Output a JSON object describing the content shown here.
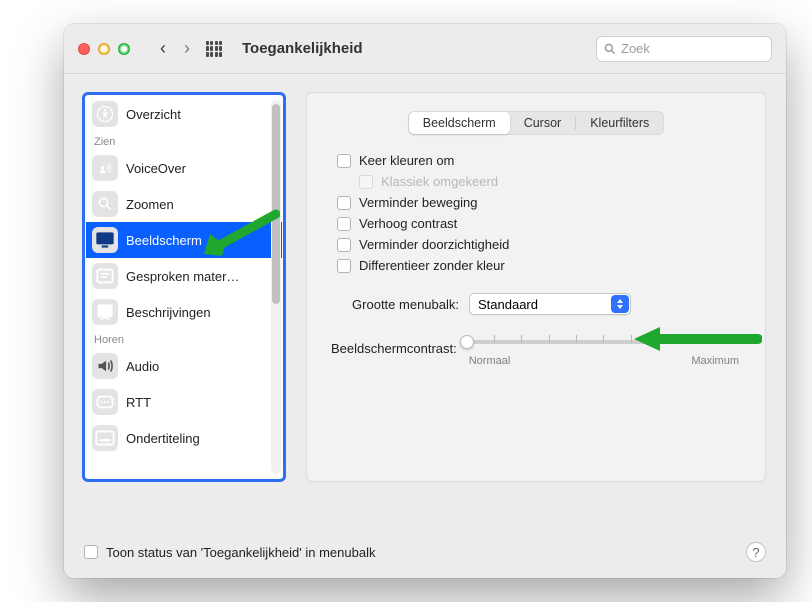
{
  "window": {
    "title": "Toegankelijkheid",
    "search_placeholder": "Zoek"
  },
  "sidebar": {
    "sections": {
      "zien": "Zien",
      "horen": "Horen"
    },
    "items": [
      {
        "id": "overzicht",
        "label": "Overzicht"
      },
      {
        "id": "voiceover",
        "label": "VoiceOver"
      },
      {
        "id": "zoomen",
        "label": "Zoomen"
      },
      {
        "id": "beeldscherm",
        "label": "Beeldscherm",
        "selected": true
      },
      {
        "id": "gesproken",
        "label": "Gesproken mater…"
      },
      {
        "id": "beschrijvingen",
        "label": "Beschrijvingen"
      },
      {
        "id": "audio",
        "label": "Audio"
      },
      {
        "id": "rtt",
        "label": "RTT"
      },
      {
        "id": "ondertiteling",
        "label": "Ondertiteling"
      }
    ]
  },
  "panel": {
    "tabs": [
      {
        "id": "beeldscherm",
        "label": "Beeldscherm",
        "active": true
      },
      {
        "id": "cursor",
        "label": "Cursor"
      },
      {
        "id": "kleurfilters",
        "label": "Kleurfilters"
      }
    ],
    "checkboxes": {
      "invert": "Keer kleuren om",
      "classic_invert": "Klassiek omgekeerd",
      "reduce_motion": "Verminder beweging",
      "increase_contrast": "Verhoog contrast",
      "reduce_transparency": "Verminder doorzichtigheid",
      "differentiate": "Differentieer zonder kleur"
    },
    "menubar_size": {
      "label": "Grootte menubalk:",
      "value": "Standaard"
    },
    "contrast": {
      "label": "Beeldschermcontrast:",
      "min_label": "Normaal",
      "max_label": "Maximum"
    }
  },
  "footer": {
    "show_status_label": "Toon status van 'Toegankelijkheid' in menubalk"
  }
}
